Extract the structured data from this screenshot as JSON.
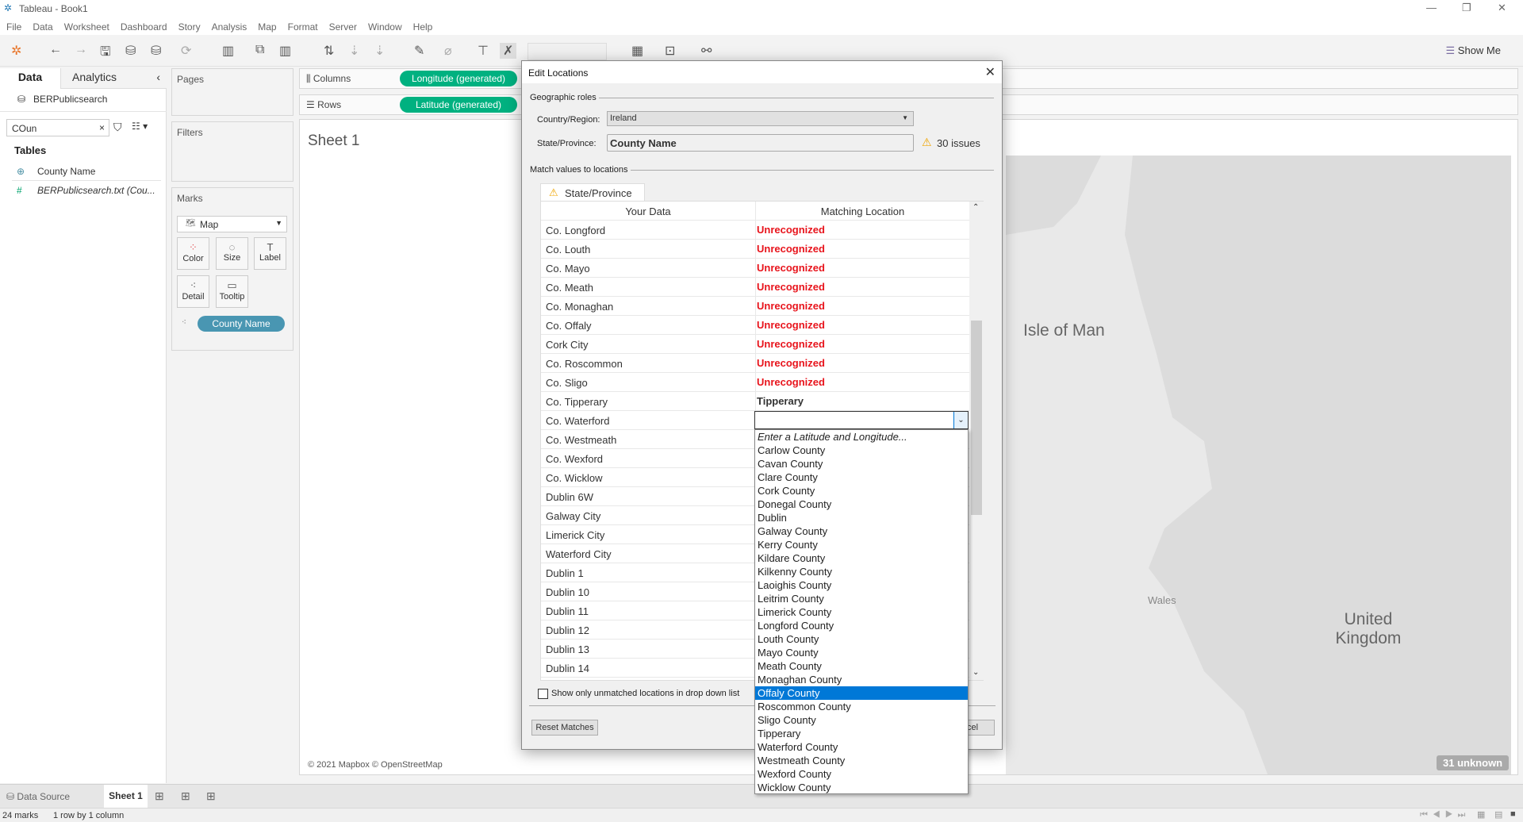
{
  "window": {
    "title": "Tableau - Book1"
  },
  "menu": [
    "File",
    "Data",
    "Worksheet",
    "Dashboard",
    "Story",
    "Analysis",
    "Map",
    "Format",
    "Server",
    "Window",
    "Help"
  ],
  "toolbar": {
    "show_me": "Show Me"
  },
  "left_panel": {
    "tab_data": "Data",
    "tab_analytics": "Analytics",
    "datasource": "BERPublicsearch",
    "search_value": "COun",
    "tables_heading": "Tables",
    "fields": [
      {
        "name": "County Name",
        "icon": "globe-icon"
      },
      {
        "name": "BERPublicsearch.txt (Cou...",
        "icon": "hash-icon"
      }
    ]
  },
  "cards": {
    "pages": "Pages",
    "filters": "Filters",
    "marks": "Marks",
    "mark_type": "Map",
    "mark_buttons": [
      "Color",
      "Size",
      "Label",
      "Detail",
      "Tooltip"
    ],
    "detail_pill": "County Name"
  },
  "shelves": {
    "columns_label": "Columns",
    "columns_pill": "Longitude (generated)",
    "rows_label": "Rows",
    "rows_pill": "Latitude (generated)",
    "pill_color": "#00b180"
  },
  "sheet": {
    "title": "Sheet 1",
    "attribution": "© 2021 Mapbox © OpenStreetMap",
    "unknown_badge": "31 unknown",
    "map_labels": [
      "Isle of Man",
      "Wales",
      "United Kingdom"
    ]
  },
  "dialog": {
    "title": "Edit Locations",
    "geo_roles": "Geographic roles",
    "country_label": "Country/Region:",
    "country_value": "Ireland",
    "state_label": "State/Province:",
    "state_value": "County Name",
    "issues": "30 issues",
    "match_heading": "Match values to locations",
    "tab": "State/Province",
    "col_your_data": "Your Data",
    "col_matching": "Matching Location",
    "rows": [
      {
        "data": "Co. Longford",
        "match": "Unrecognized"
      },
      {
        "data": "Co. Louth",
        "match": "Unrecognized"
      },
      {
        "data": "Co. Mayo",
        "match": "Unrecognized"
      },
      {
        "data": "Co. Meath",
        "match": "Unrecognized"
      },
      {
        "data": "Co. Monaghan",
        "match": "Unrecognized"
      },
      {
        "data": "Co. Offaly",
        "match": "Unrecognized"
      },
      {
        "data": "Cork City",
        "match": "Unrecognized"
      },
      {
        "data": "Co. Roscommon",
        "match": "Unrecognized"
      },
      {
        "data": "Co. Sligo",
        "match": "Unrecognized"
      },
      {
        "data": "Co. Tipperary",
        "match": "Tipperary"
      },
      {
        "data": "Co. Waterford",
        "match": ""
      },
      {
        "data": "Co. Westmeath",
        "match": ""
      },
      {
        "data": "Co. Wexford",
        "match": ""
      },
      {
        "data": "Co. Wicklow",
        "match": ""
      },
      {
        "data": "Dublin 6W",
        "match": ""
      },
      {
        "data": "Galway City",
        "match": ""
      },
      {
        "data": "Limerick City",
        "match": ""
      },
      {
        "data": "Waterford City",
        "match": ""
      },
      {
        "data": "Dublin 1",
        "match": ""
      },
      {
        "data": "Dublin 10",
        "match": ""
      },
      {
        "data": "Dublin 11",
        "match": ""
      },
      {
        "data": "Dublin 12",
        "match": ""
      },
      {
        "data": "Dublin 13",
        "match": ""
      },
      {
        "data": "Dublin 14",
        "match": ""
      }
    ],
    "unrecognized_color": "#e8141c",
    "checkbox_label": "Show only unmatched locations in drop down list",
    "reset_button": "Reset Matches",
    "cancel_button": "Cancel",
    "dropdown_options": [
      "Enter a Latitude and Longitude...",
      "Carlow County",
      "Cavan County",
      "Clare County",
      "Cork County",
      "Donegal County",
      "Dublin",
      "Galway County",
      "Kerry County",
      "Kildare County",
      "Kilkenny County",
      "Laoighis County",
      "Leitrim County",
      "Limerick County",
      "Longford County",
      "Louth County",
      "Mayo County",
      "Meath County",
      "Monaghan County",
      "Offaly County",
      "Roscommon County",
      "Sligo County",
      "Tipperary",
      "Waterford County",
      "Westmeath County",
      "Wexford County",
      "Wicklow County"
    ],
    "dropdown_selected": "Offaly County"
  },
  "bottom": {
    "data_source_tab": "Data Source",
    "sheet_tab": "Sheet 1",
    "status_marks": "24 marks",
    "status_dims": "1 row by 1 column"
  }
}
